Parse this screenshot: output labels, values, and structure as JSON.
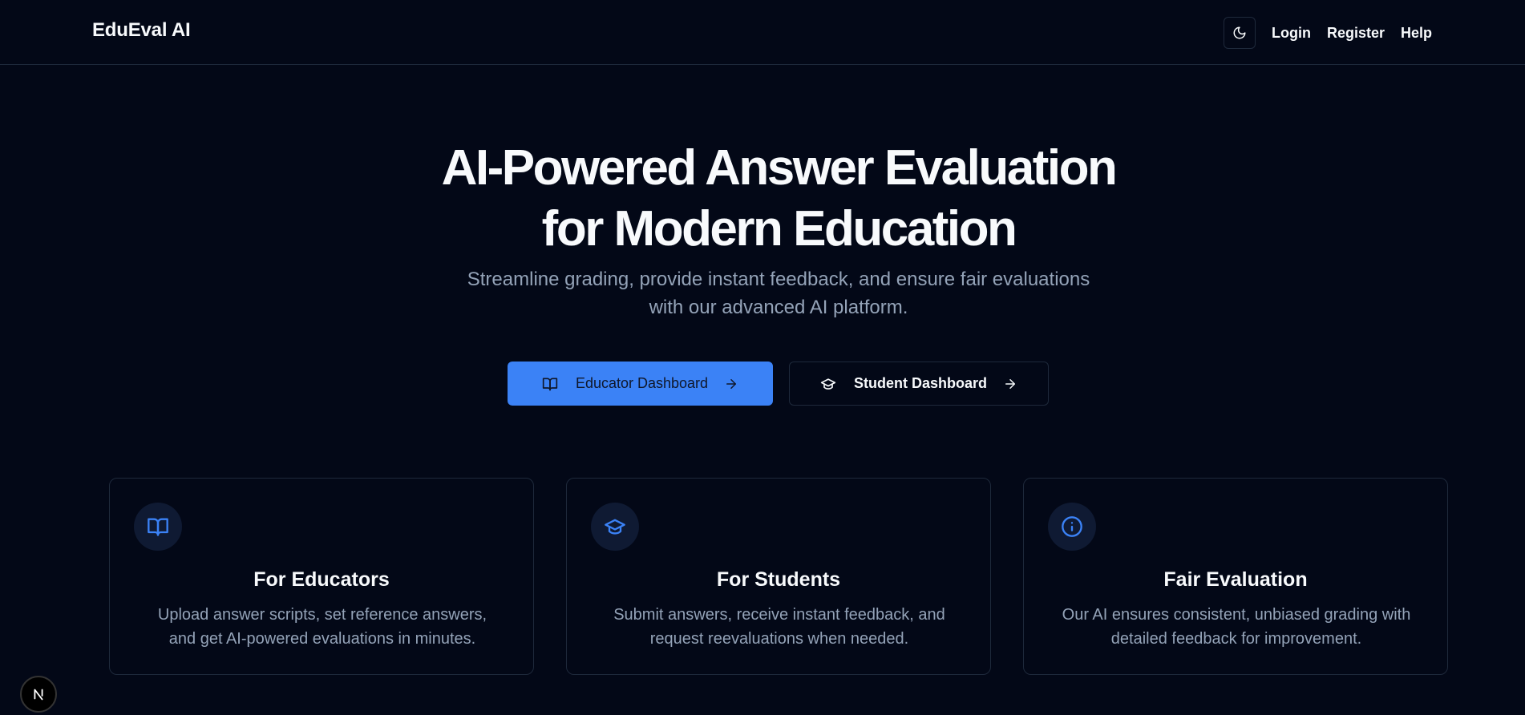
{
  "nav": {
    "brand": "EduEval AI",
    "theme_toggle_icon": "moon-icon",
    "links": [
      "Login",
      "Register",
      "Help"
    ]
  },
  "hero": {
    "title_line1": "AI-Powered Answer Evaluation",
    "title_line2": "for Modern Education",
    "subtitle_line1": "Streamline grading, provide instant feedback, and ensure fair evaluations",
    "subtitle_line2": "with our advanced AI platform."
  },
  "cta": {
    "educator": {
      "label": "Educator Dashboard",
      "icon": "book-open-icon"
    },
    "student": {
      "label": "Student Dashboard",
      "icon": "graduation-cap-icon"
    }
  },
  "features": [
    {
      "icon": "book-open-icon",
      "title": "For Educators",
      "desc_line1": "Upload answer scripts, set reference answers,",
      "desc_line2": "and get AI-powered evaluations in minutes."
    },
    {
      "icon": "graduation-cap-icon",
      "title": "For Students",
      "desc_line1": "Submit answers, receive instant feedback, and",
      "desc_line2": "request reevaluations when needed."
    },
    {
      "icon": "info-icon",
      "title": "Fair Evaluation",
      "desc_line1": "Our AI ensures consistent, unbiased grading with",
      "desc_line2": "detailed feedback for improvement."
    }
  ],
  "badge": {
    "text": "N"
  },
  "colors": {
    "background": "#030817",
    "accent": "#3b82f6",
    "border": "#1e293b",
    "muted_text": "#94a3b8"
  }
}
